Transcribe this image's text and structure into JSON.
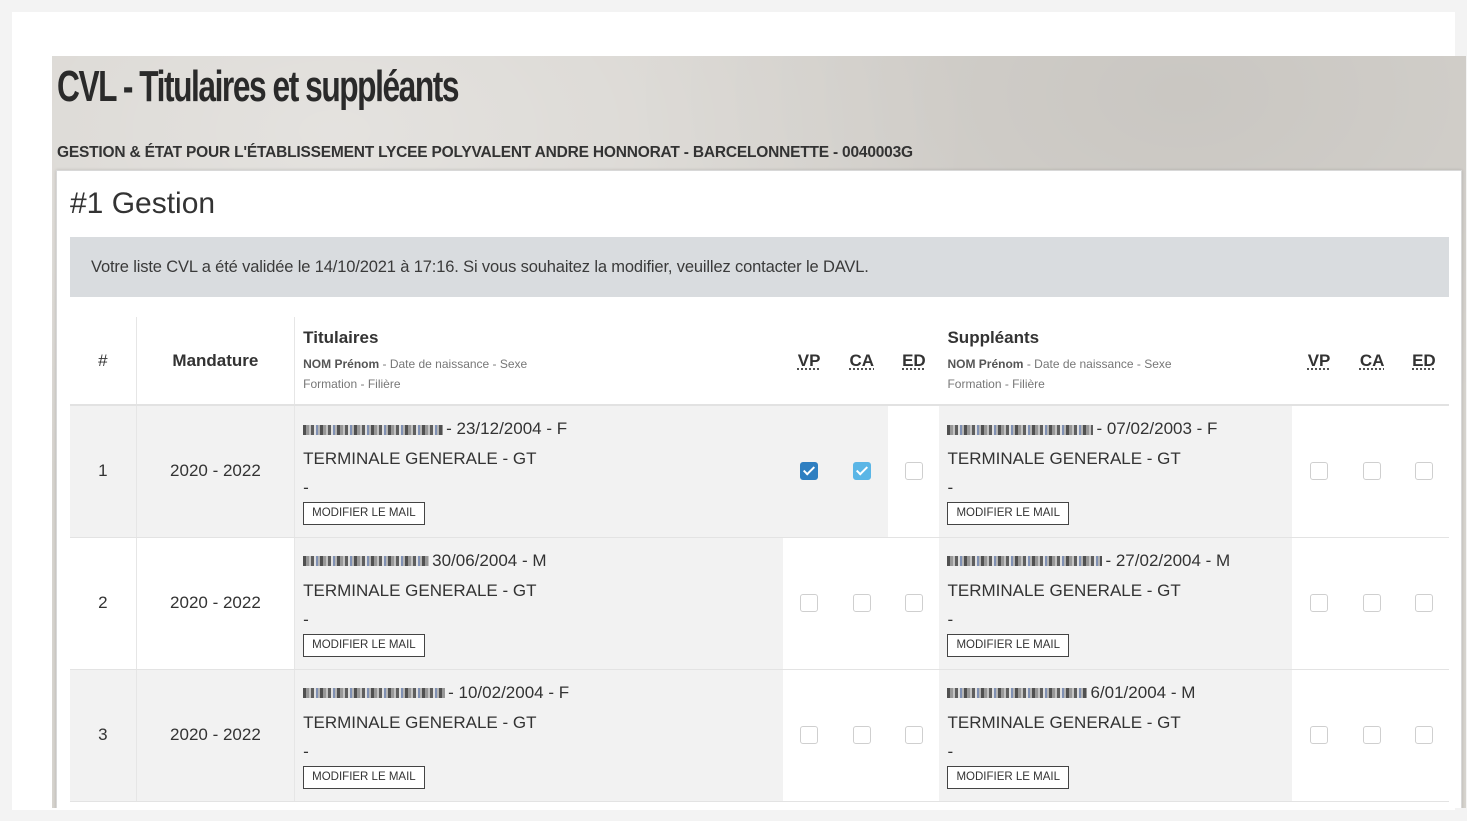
{
  "page": {
    "title": "CVL - Titulaires et suppléants",
    "subtitle": "GESTION & ÉTAT POUR L'ÉTABLISSEMENT LYCEE POLYVALENT ANDRE HONNORAT - BARCELONNETTE - 0040003G"
  },
  "section": {
    "title": "#1 Gestion",
    "alert": "Votre liste CVL a été validée le 14/10/2021 à 17:16. Si vous souhaitez la modifier, veuillez contacter le DAVL."
  },
  "table": {
    "headers": {
      "num": "#",
      "mandature": "Mandature",
      "titulaires": "Titulaires",
      "suppleants": "Suppléants",
      "sub_nom": "NOM Prénom",
      "sub_rest": " - Date de naissance - Sexe",
      "sub_line2": "Formation - Filière",
      "vp": "VP",
      "ca": "CA",
      "ed": "ED"
    },
    "button_label": "MODIFIER LE MAIL",
    "rows": [
      {
        "num": "1",
        "mandature": "2020 - 2022",
        "titulaire": {
          "birth": "- 23/12/2004 - F",
          "formation": "TERMINALE GENERALE - GT",
          "extra": "-"
        },
        "titulaire_roles": {
          "vp": true,
          "ca": true,
          "ed": false
        },
        "suppleant": {
          "birth": "- 07/02/2003 - F",
          "formation": "TERMINALE GENERALE - GT",
          "extra": "-"
        },
        "suppleant_roles": {
          "vp": false,
          "ca": false,
          "ed": false
        }
      },
      {
        "num": "2",
        "mandature": "2020 - 2022",
        "titulaire": {
          "birth": "30/06/2004 - M",
          "formation": "TERMINALE GENERALE - GT",
          "extra": "-"
        },
        "titulaire_roles": {
          "vp": false,
          "ca": false,
          "ed": false
        },
        "suppleant": {
          "birth": "- 27/02/2004 - M",
          "formation": "TERMINALE GENERALE - GT",
          "extra": "-"
        },
        "suppleant_roles": {
          "vp": false,
          "ca": false,
          "ed": false
        }
      },
      {
        "num": "3",
        "mandature": "2020 - 2022",
        "titulaire": {
          "birth": "- 10/02/2004 - F",
          "formation": "TERMINALE GENERALE - GT",
          "extra": "-"
        },
        "titulaire_roles": {
          "vp": false,
          "ca": false,
          "ed": false
        },
        "suppleant": {
          "birth": "6/01/2004 - M",
          "formation": "TERMINALE GENERALE - GT",
          "extra": "-"
        },
        "suppleant_roles": {
          "vp": false,
          "ca": false,
          "ed": false
        }
      }
    ]
  }
}
